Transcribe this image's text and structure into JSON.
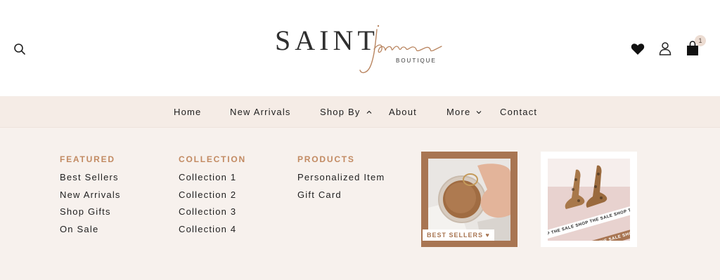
{
  "header": {
    "logo": {
      "main": "SAINT",
      "script": "james",
      "sub": "BOUTIQUE"
    },
    "icons": {
      "search": "search-icon",
      "wishlist": "heart-icon",
      "account": "user-icon",
      "cart": "shopping-bag-icon"
    },
    "cart_count": "1"
  },
  "nav": {
    "items": [
      {
        "label": "Home"
      },
      {
        "label": "New Arrivals"
      },
      {
        "label": "Shop By",
        "expanded": true
      },
      {
        "label": "About"
      },
      {
        "label": "More",
        "expanded": false
      },
      {
        "label": "Contact"
      }
    ]
  },
  "mega": {
    "columns": [
      {
        "title": "FEATURED",
        "links": [
          "Best Sellers",
          "New Arrivals",
          "Shop Gifts",
          "On Sale"
        ]
      },
      {
        "title": "COLLECTION",
        "links": [
          "Collection 1",
          "Collection 2",
          "Collection 3",
          "Collection 4"
        ]
      },
      {
        "title": "PRODUCTS",
        "links": [
          "Personalized Item",
          "Gift Card"
        ]
      }
    ],
    "promos": [
      {
        "tag": "BEST SELLERS"
      },
      {
        "ribbon": "SHOP THE SALE SHOP THE SALE SHOP THE SALE SHOP THE SALE"
      }
    ]
  },
  "colors": {
    "accent": "#c28a62",
    "promo_bg": "#a87552",
    "nav_bg": "#f5ece6",
    "page_bg": "#f7f1ed"
  }
}
